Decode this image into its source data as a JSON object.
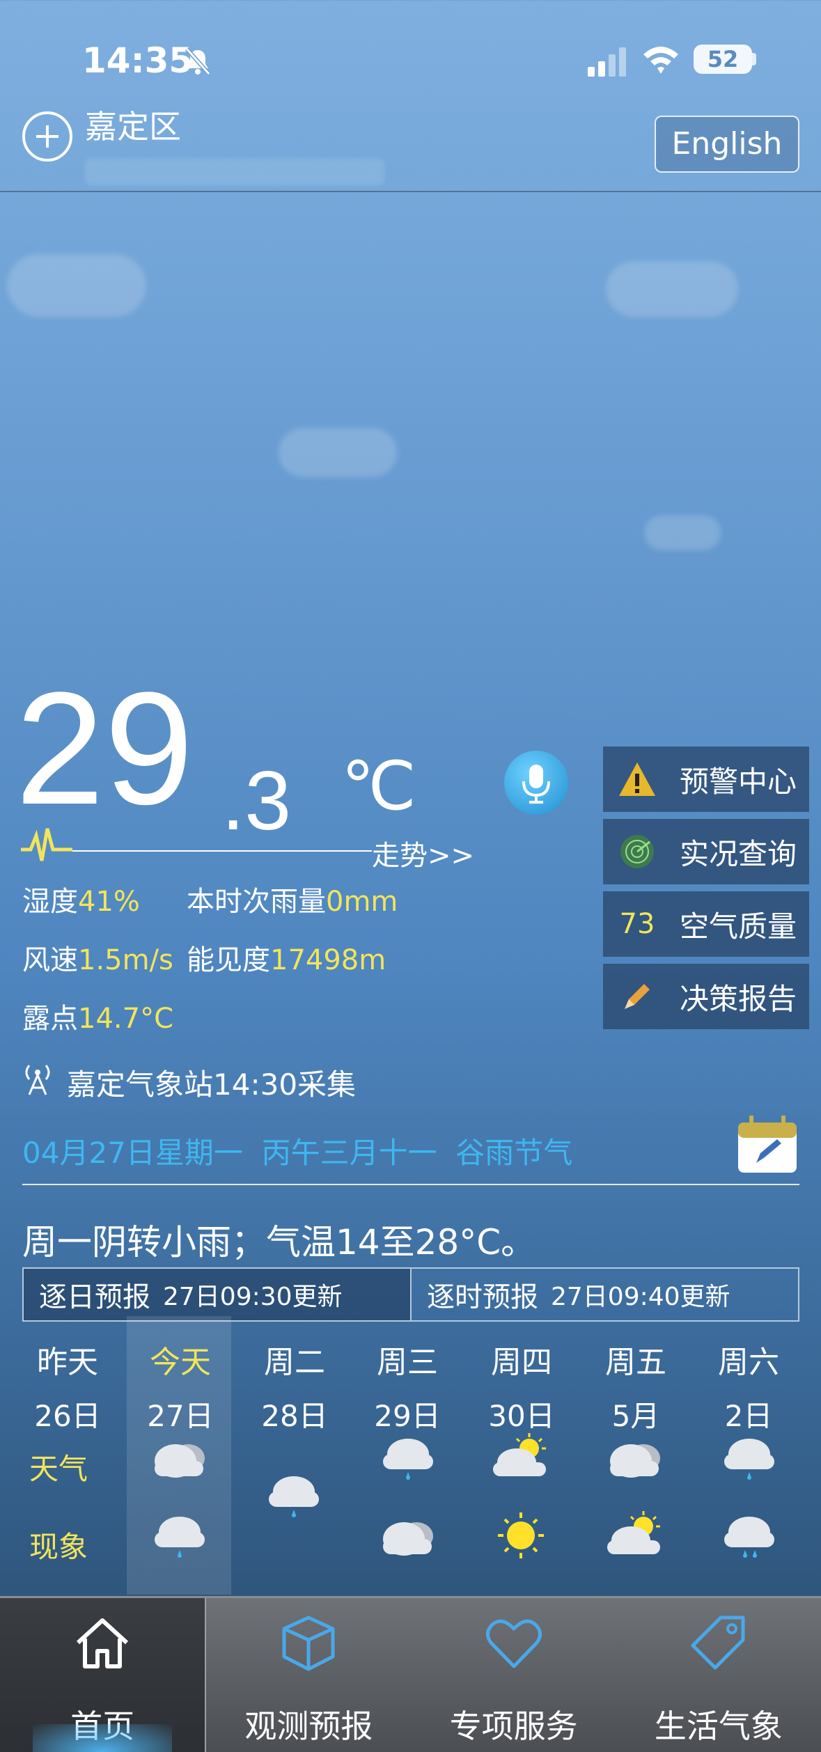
{
  "status_bar": {
    "time": "14:35",
    "battery": "52"
  },
  "header": {
    "location": "嘉定区",
    "lang_button": "English"
  },
  "current": {
    "temp_int": "29",
    "temp_dec": ".3",
    "temp_unit": "℃",
    "trend_link": "走势>>",
    "humidity_label": "湿度",
    "humidity": "41%",
    "rain_label": "本时次雨量",
    "rain": "0mm",
    "wind_label": "风速",
    "wind": "1.5m/s",
    "visibility_label": "能见度",
    "visibility": "17498m",
    "dew_label": "露点",
    "dew": "14.7°C",
    "station": "嘉定气象站14:30采集"
  },
  "side_buttons": [
    {
      "label": "预警中心",
      "icon": "warning-icon"
    },
    {
      "label": "实况查询",
      "icon": "radar-icon"
    },
    {
      "label": "空气质量",
      "badge": "73"
    },
    {
      "label": "决策报告",
      "icon": "pencil-icon"
    }
  ],
  "date_line": "04月27日星期一  丙午三月十一  谷雨节气",
  "summary": "周一阴转小雨；气温14至28°C。",
  "tabs": [
    {
      "label": "逐日预报",
      "updated": "27日09:30更新"
    },
    {
      "label": "逐时预报",
      "updated": "27日09:40更新"
    }
  ],
  "forecast": {
    "row_labels": {
      "weather": "天气",
      "phenomenon": "现象"
    },
    "days": [
      {
        "name": "昨天",
        "date": "26日",
        "day_icon": "",
        "night_icon": ""
      },
      {
        "name": "今天",
        "date": "27日",
        "day_icon": "cloudy-icon",
        "night_icon": "light-rain-icon"
      },
      {
        "name": "周二",
        "date": "28日",
        "day_icon": "light-rain-icon",
        "night_icon": ""
      },
      {
        "name": "周三",
        "date": "29日",
        "day_icon": "light-rain-icon",
        "night_icon": "cloudy-icon"
      },
      {
        "name": "周四",
        "date": "30日",
        "day_icon": "partly-sunny-icon",
        "night_icon": "sunny-icon"
      },
      {
        "name": "周五",
        "date": "5月",
        "day_icon": "cloudy-icon",
        "night_icon": "partly-sunny-icon"
      },
      {
        "name": "周六",
        "date": "2日",
        "day_icon": "light-rain-icon",
        "night_icon": "light-rain-icon"
      }
    ]
  },
  "nav": [
    {
      "label": "首页",
      "icon": "home-icon"
    },
    {
      "label": "观测预报",
      "icon": "cube-icon"
    },
    {
      "label": "专项服务",
      "icon": "heart-icon"
    },
    {
      "label": "生活气象",
      "icon": "tag-icon"
    }
  ],
  "colors": {
    "accent_yellow": "#F2E55B",
    "accent_blue": "#3FB7F0"
  }
}
